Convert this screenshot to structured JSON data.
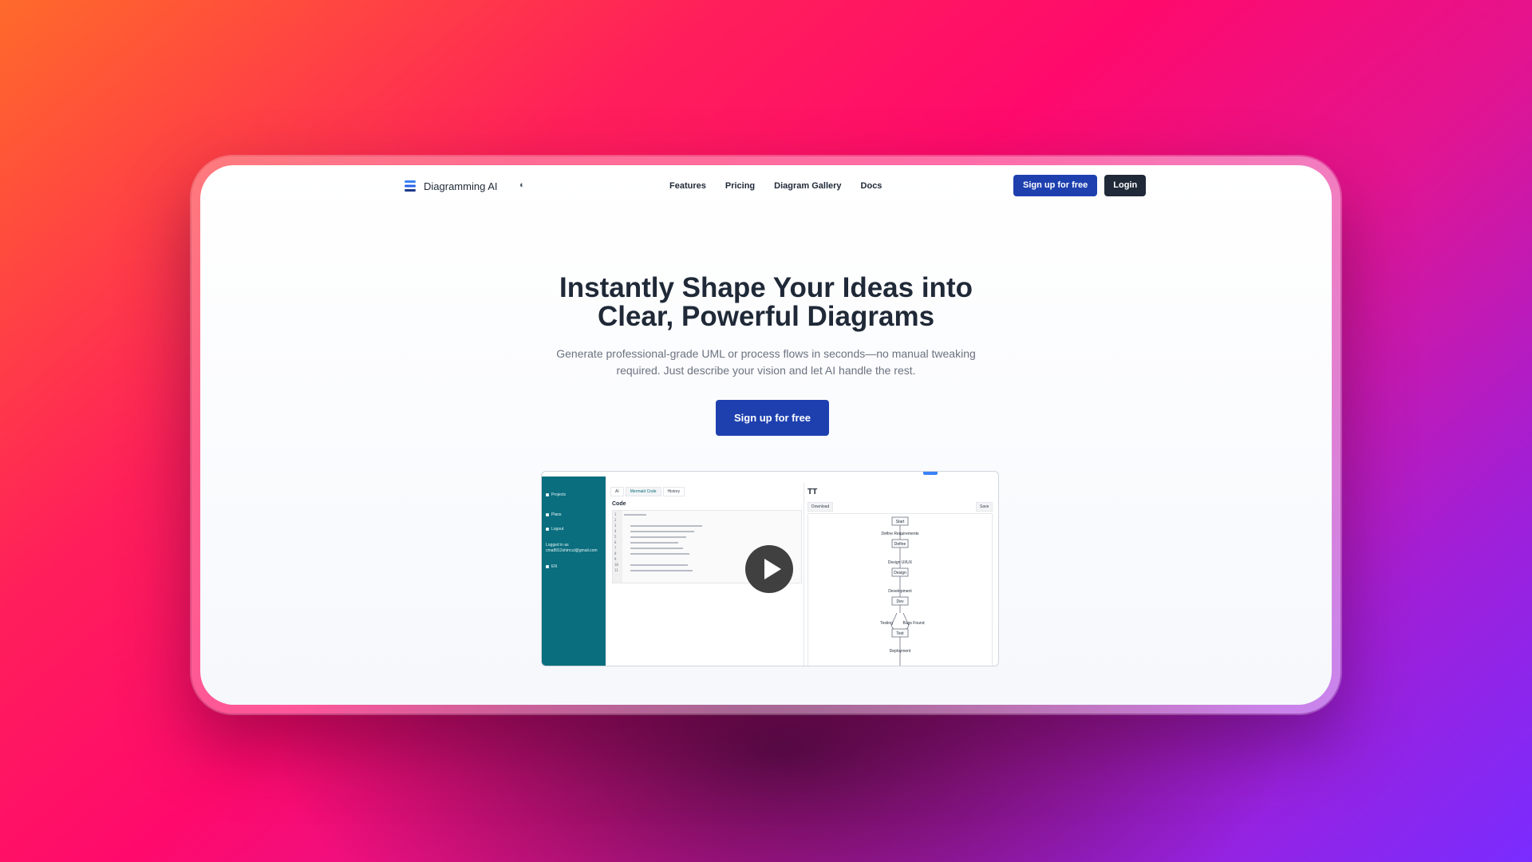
{
  "brand": {
    "name": "Diagramming AI"
  },
  "nav": {
    "links": [
      "Features",
      "Pricing",
      "Diagram Gallery",
      "Docs"
    ],
    "signup_label": "Sign up for free",
    "login_label": "Login"
  },
  "hero": {
    "title_line1": "Instantly Shape Your Ideas into",
    "title_line2": "Clear, Powerful Diagrams",
    "subtitle_line1": "Generate professional-grade UML or process flows in seconds—no manual tweaking",
    "subtitle_line2": "required. Just describe your vision and let AI handle the rest.",
    "cta_label": "Sign up for free"
  },
  "preview": {
    "sidebar": {
      "projects": "Projects",
      "plans": "Plans",
      "logout": "Logout",
      "logged_in_as": "Logged in as",
      "email": "cma8912shirrcul@gmail.com",
      "lang": "EN"
    },
    "tabs": [
      "AI",
      "Mermaid Code",
      "History"
    ],
    "code_label": "Code",
    "line_numbers": [
      "1",
      "2",
      "3",
      "4",
      "5",
      "6",
      "7",
      "8",
      "9",
      "10",
      "11"
    ],
    "title": "TT",
    "download_label": "Download",
    "save_label": "Save",
    "flow": {
      "nodes": [
        "Start",
        "Define",
        "Design",
        "Dev",
        "Test"
      ],
      "edge_labels": [
        "Define Requirements",
        "Design UI/UX",
        "Development",
        "Testing",
        "Bugs Found",
        "Deployment"
      ]
    }
  },
  "colors": {
    "primary": "#1e40af",
    "dark": "#1f2937",
    "sidebar": "#0a6e7e"
  }
}
